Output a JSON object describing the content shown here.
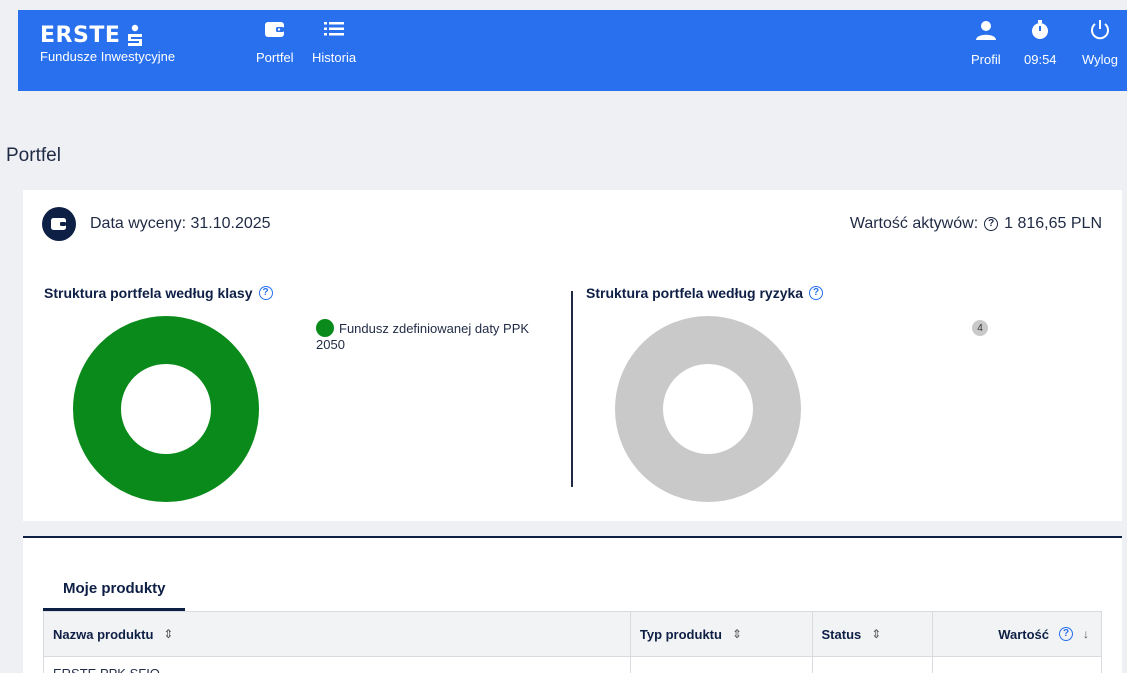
{
  "header": {
    "logo_word": "ERSTE",
    "logo_sub": "Fundusze Inwestycyjne",
    "nav": {
      "portfel": "Portfel",
      "historia": "Historia"
    },
    "profil": "Profil",
    "session_time": "09:54",
    "logout": "Wylog",
    "color": "#2870ed"
  },
  "page": {
    "title": "Portfel"
  },
  "summary": {
    "valuation": "Data wyceny: 31.10.2025",
    "assets_label": "Wartość aktywów:",
    "assets_value": "1 816,65 PLN",
    "help_glyph": "?"
  },
  "structure_class": {
    "title": "Struktura portfela według klasy",
    "legend": "Fundusz zdefiniowanej daty PPK 2050",
    "color": "#0a8a1a"
  },
  "structure_risk": {
    "title": "Struktura portfela według ryzyka",
    "badge": "4",
    "color": "#c9c9c9"
  },
  "products": {
    "tab": "Moje produkty",
    "columns": [
      "Nazwa produktu",
      "Typ produktu",
      "Status",
      "Wartość"
    ],
    "rows": [
      [
        "ERSTE PPK SFIO",
        "",
        "",
        ""
      ]
    ]
  }
}
